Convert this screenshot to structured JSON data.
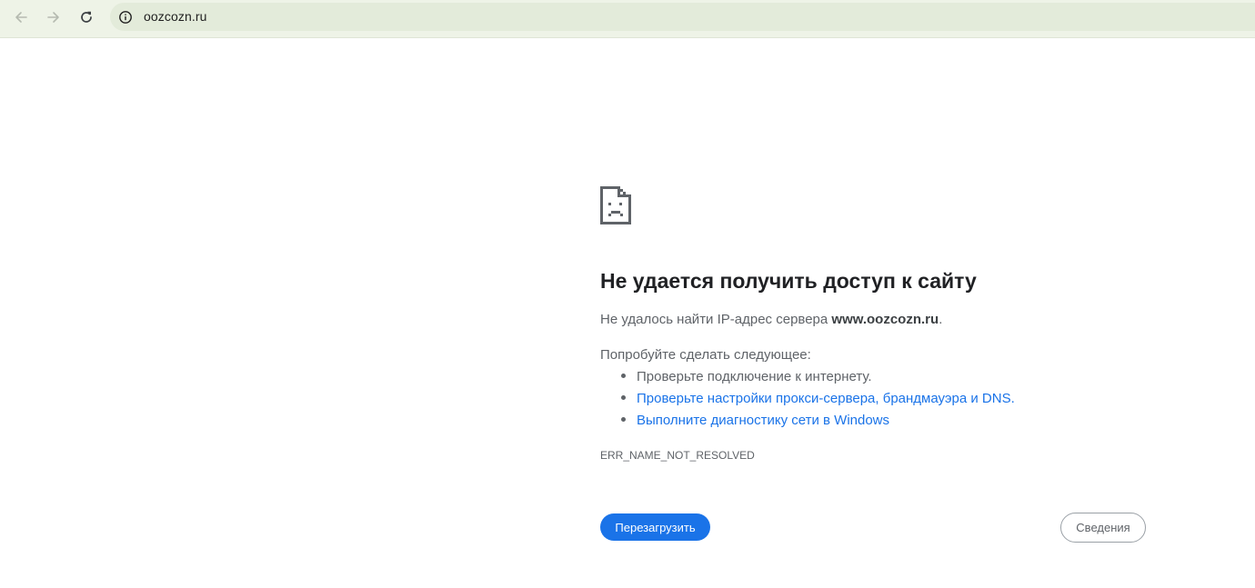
{
  "browser": {
    "url": "oozcozn.ru",
    "icons": {
      "back": "arrow-left-icon",
      "forward": "arrow-right-icon",
      "reload": "reload-icon",
      "site_info": "info-circle-icon"
    }
  },
  "error_page": {
    "icon": "sad-page-icon",
    "title": "Не удается получить доступ к сайту",
    "summary_prefix": "Не удалось найти IP-адрес сервера ",
    "summary_host": "www.oozcozn.ru",
    "summary_suffix": ".",
    "suggestions_heading": "Попробуйте сделать следующее:",
    "suggestions": [
      {
        "text": "Проверьте подключение к интернету.",
        "is_link": false
      },
      {
        "text": "Проверьте настройки прокси-сервера, брандмауэра и DNS.",
        "is_link": true
      },
      {
        "text": "Выполните диагностику сети в Windows",
        "is_link": true
      }
    ],
    "error_code": "ERR_NAME_NOT_RESOLVED",
    "reload_label": "Перезагрузить",
    "details_label": "Сведения"
  },
  "colors": {
    "toolbar_bg": "#eef3e7",
    "omnibox_bg": "#e3ebda",
    "link": "#1a73e8",
    "primary_button": "#1a73e8",
    "text_title": "#202124",
    "text_body": "#5f6368"
  }
}
